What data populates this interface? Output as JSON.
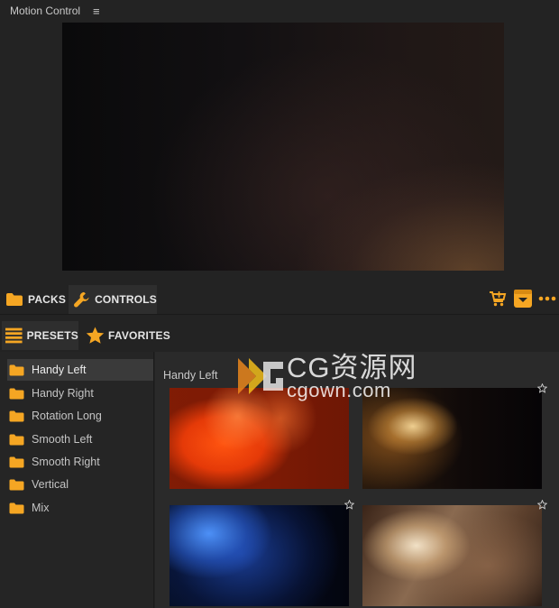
{
  "window": {
    "title": "Motion Control",
    "menu_glyph": "≡"
  },
  "colors": {
    "accent": "#f5a623",
    "background": "#232323",
    "panel": "#2a2a2a",
    "selected": "#3a3a3a"
  },
  "top_tabs": [
    {
      "label": "PACKS",
      "icon": "folder-icon"
    },
    {
      "label": "CONTROLS",
      "icon": "wrench-icon"
    }
  ],
  "toolbar_icons": [
    "cart-icon",
    "download-box-icon",
    "more-icon"
  ],
  "sub_tabs": [
    {
      "label": "PRESETS",
      "icon": "list-icon"
    },
    {
      "label": "FAVORITES",
      "icon": "star-icon"
    }
  ],
  "presets": [
    {
      "label": "Handy Left",
      "selected": true
    },
    {
      "label": "Handy Right"
    },
    {
      "label": "Rotation Long"
    },
    {
      "label": "Smooth Left"
    },
    {
      "label": "Smooth Right"
    },
    {
      "label": "Vertical"
    },
    {
      "label": "Mix"
    }
  ],
  "content": {
    "pack_title": "Handy Left"
  },
  "watermark": {
    "line1": "CG资源网",
    "line2": "cgown.com"
  }
}
